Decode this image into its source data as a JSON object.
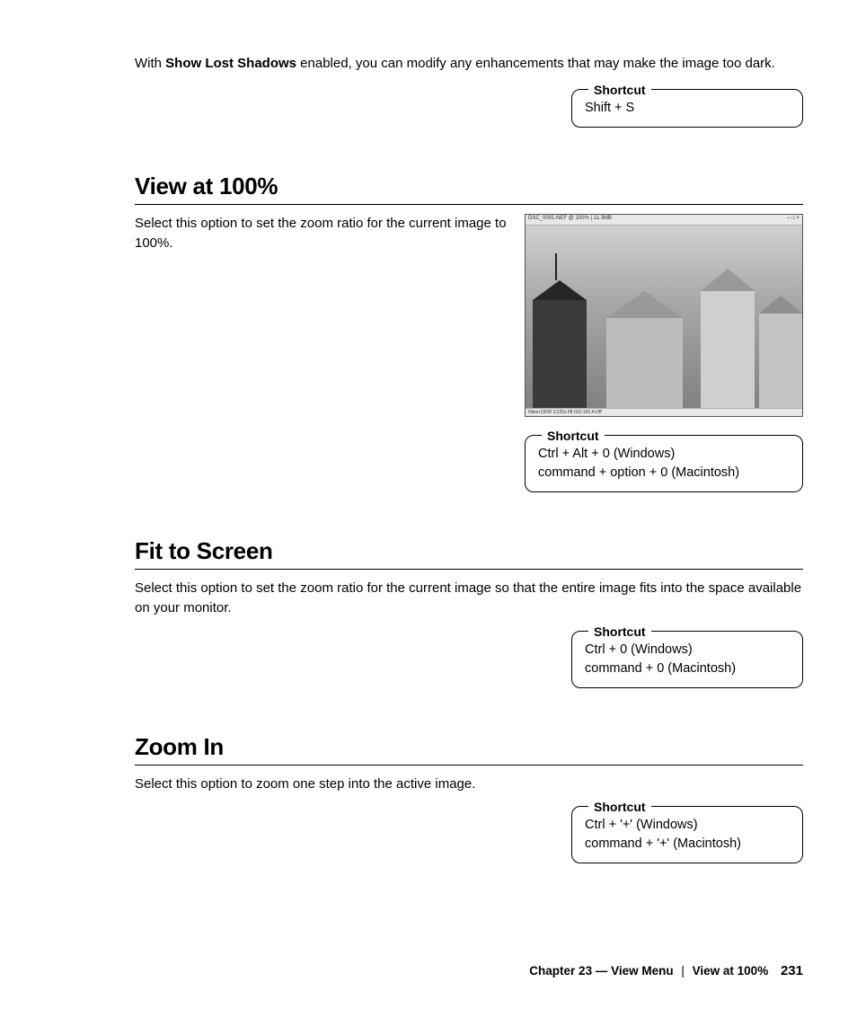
{
  "intro": {
    "prefix": "With ",
    "bold": "Show Lost Shadows",
    "suffix": " enabled, you can modify any enhancements that may make the image too dark."
  },
  "shortcut_label": "Shortcut",
  "sections": {
    "show_lost_shadows_shortcut": {
      "line1": "Shift + S"
    },
    "view_100": {
      "heading": "View at 100%",
      "body": "Select this option to set the zoom ratio for the current image to 100%.",
      "image_title": "DSC_0001.NEF @ 100% | 11.3MB",
      "image_title_right": "– □ ×",
      "image_status": "Nikon D500 1/125s f/8   ISO:100 A:Off",
      "shortcut_line1": "Ctrl + Alt + 0 (Windows)",
      "shortcut_line2": "command + option + 0 (Macintosh)"
    },
    "fit_to_screen": {
      "heading": "Fit to Screen",
      "body": "Select this option to set the zoom ratio for the current image so that the entire image fits into the space available on your monitor.",
      "shortcut_line1": "Ctrl + 0 (Windows)",
      "shortcut_line2": "command + 0 (Macintosh)"
    },
    "zoom_in": {
      "heading": "Zoom In",
      "body": "Select this option to zoom one step into the active image.",
      "shortcut_line1": "Ctrl + '+' (Windows)",
      "shortcut_line2": "command + '+' (Macintosh)"
    }
  },
  "footer": {
    "chapter": "Chapter 23 — View Menu",
    "topic": "View at 100%",
    "page": "231"
  }
}
